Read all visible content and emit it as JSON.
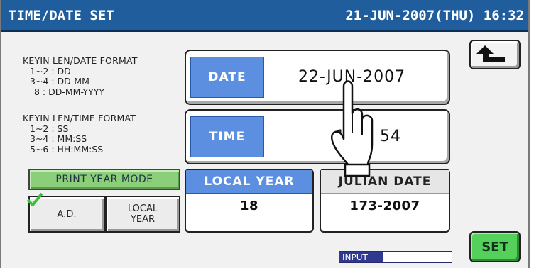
{
  "header": {
    "title": "TIME/DATE SET",
    "datetime": "21-JUN-2007(THU) 16:32"
  },
  "date_format": {
    "heading": "KEYIN LEN/DATE FORMAT",
    "rows": [
      "1~2 : DD",
      "3~4 : DD-MM",
      "8 : DD-MM-YYYY"
    ]
  },
  "time_format": {
    "heading": "KEYIN LEN/TIME FORMAT",
    "rows": [
      "1~2 : SS",
      "3~4 : MM:SS",
      "5~6 : HH:MM:SS"
    ]
  },
  "date_field": {
    "label": "DATE",
    "value": "22-JUN-2007"
  },
  "time_field": {
    "label": "TIME",
    "value": "1      54"
  },
  "print_year": {
    "label": "PRINT YEAR MODE",
    "options": [
      {
        "label": "A.D.",
        "selected": true
      },
      {
        "label": "LOCAL YEAR",
        "selected": false
      }
    ]
  },
  "local_year": {
    "label": "LOCAL YEAR",
    "value": "18"
  },
  "julian_date": {
    "label": "JULIAN DATE",
    "value": "173-2007"
  },
  "set_button": {
    "label": "SET"
  },
  "input_bar": {
    "label": "INPUT"
  },
  "icons": {
    "back": "back-arrow-icon",
    "pointer": "hand-pointer-icon",
    "check": "checkmark-icon"
  },
  "colors": {
    "titlebar": "#1f5d9c",
    "field_label": "#5c8fe0",
    "set": "#55d05a",
    "print_year": "#8ccf7a"
  }
}
